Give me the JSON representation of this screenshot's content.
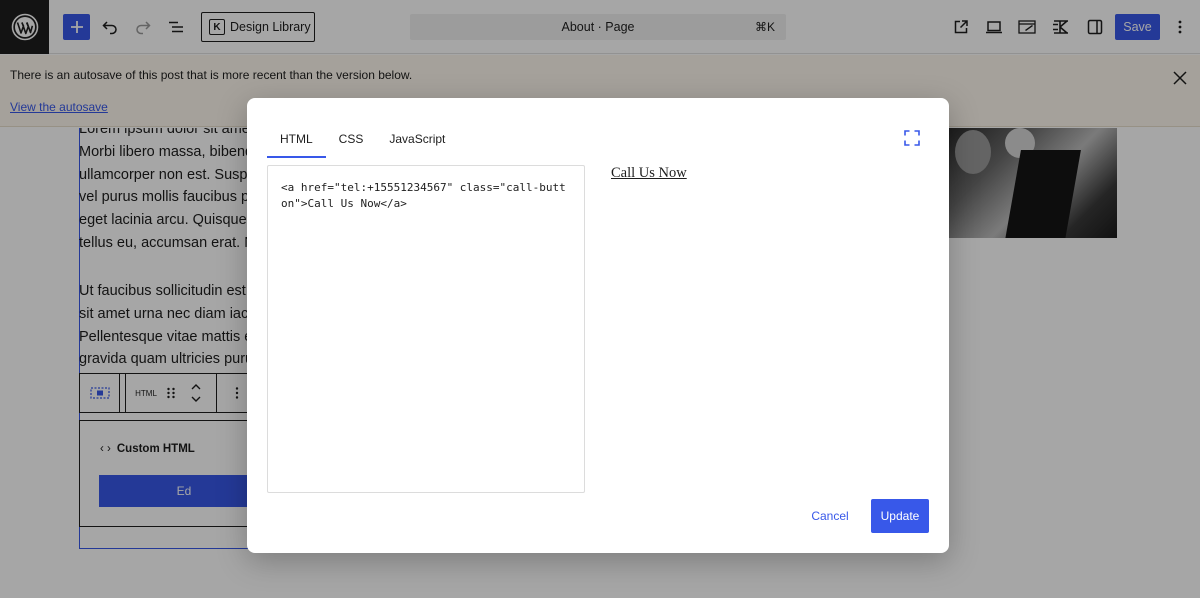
{
  "topbar": {
    "design_library_label": "Design Library",
    "design_library_badge": "K",
    "command_title": "About · Page",
    "command_shortcut": "⌘K",
    "save_label": "Save",
    "accent_color": "#3858e9"
  },
  "notice": {
    "message": "There is an autosave of this post that is more recent than the version below.",
    "link_label": "View the autosave"
  },
  "canvas": {
    "paragraph_1": [
      "Lorem ipsum dolor sit amet",
      "Morbi libero massa, bibendum",
      "ullamcorper non est. Suspendisse",
      "vel purus mollis faucibus pulvinar",
      "eget lacinia arcu. Quisque",
      "tellus eu, accumsan erat. Nam"
    ],
    "paragraph_2": [
      "Ut faucibus sollicitudin est",
      "sit amet urna nec diam iaculis",
      "Pellentesque vitae mattis eros",
      "gravida quam ultricies purus"
    ],
    "block_toolbar": {
      "html_label": "HTML"
    },
    "html_block": {
      "title": "Custom HTML",
      "button_label": "Ed"
    }
  },
  "modal": {
    "tabs": [
      {
        "label": "HTML"
      },
      {
        "label": "CSS"
      },
      {
        "label": "JavaScript"
      }
    ],
    "active_tab": "HTML",
    "code": "<a href=\"tel:+15551234567\" class=\"call-button\">Call Us Now</a>",
    "preview_link_text": "Call Us Now",
    "cancel_label": "Cancel",
    "update_label": "Update"
  }
}
